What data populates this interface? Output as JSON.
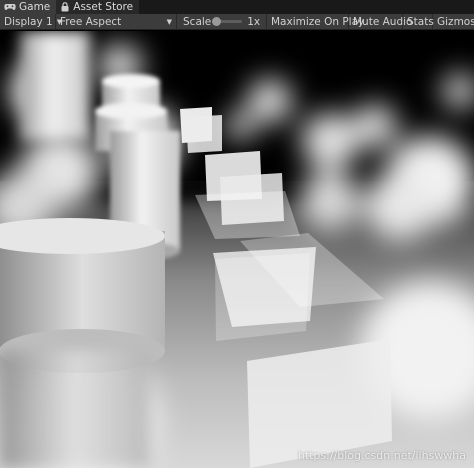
{
  "tabs": [
    {
      "label": "Game",
      "icon": "gamepad-icon",
      "active": true
    },
    {
      "label": "Asset Store",
      "icon": "lock-bag-icon",
      "active": false
    }
  ],
  "toolbar": {
    "display": "Display 1",
    "aspect": "Free Aspect",
    "scale_label": "Scale",
    "scale_value": "1x",
    "scale_fraction": 0.0,
    "maximize_on_play": "Maximize On Play",
    "mute_audio": "Mute Audio",
    "stats": "Stats",
    "gizmos": "Gizmos"
  },
  "viewport": {
    "watermark": "https://blog.csdn.net/llhswwha"
  },
  "colors": {
    "tab_bar": "#191919",
    "toolbar": "#3c3c3c",
    "viewport_bg": "#000000"
  }
}
